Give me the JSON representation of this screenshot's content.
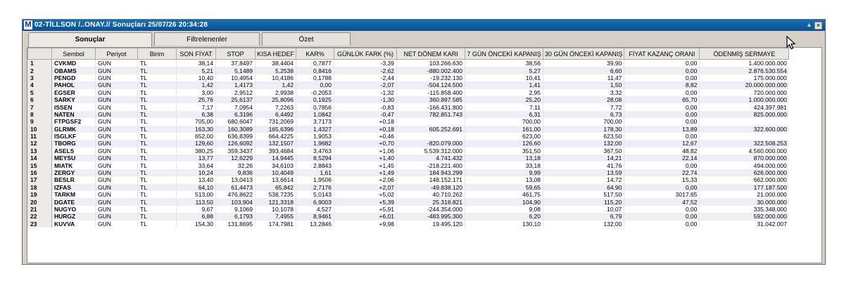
{
  "window": {
    "logo": "M",
    "title": "02-TİLLSON /..ONAY.// Sonuçları  25/07/26 20:34:28"
  },
  "tabs": [
    {
      "label": "Sonuçlar",
      "active": true
    },
    {
      "label": "Filtrelenenler",
      "active": false
    },
    {
      "label": "Özet",
      "active": false
    }
  ],
  "table": {
    "headers": [
      "",
      "Sembol",
      "Periyot",
      "Birim",
      "SON FİYAT",
      "STOP",
      "KISA HEDEF",
      "KAR%",
      "GÜNLÜK FARK (%)",
      "NET DÖNEM KARI",
      "7 GÜN ÖNCEKİ KAPANIŞ",
      "30 GÜN ÖNCEKİ KAPANIŞ",
      "FİYAT KAZANÇ ORANI",
      "ÖDENMİŞ SERMAYE"
    ],
    "rows": [
      [
        "1",
        "CVKMD",
        "GUN",
        "TL",
        "38,14",
        "37,8497",
        "38,4404",
        "0,7877",
        "-3,39",
        "103.266.630",
        "38,56",
        "39,90",
        "0,00",
        "1.400.000.000"
      ],
      [
        "2",
        "OBAMS",
        "GUN",
        "TL",
        "5,21",
        "5,1489",
        "5,2538",
        "0,8416",
        "-2,62",
        "-880.002.400",
        "5,27",
        "6,60",
        "0,00",
        "2.876.530.554"
      ],
      [
        "3",
        "PENGD",
        "GUN",
        "TL",
        "10,40",
        "10,4954",
        "10,4186",
        "0,1788",
        "-2,44",
        "-19.232.130",
        "10,41",
        "11,47",
        "0,00",
        "175.000.000"
      ],
      [
        "4",
        "PAHOL",
        "GUN",
        "TL",
        "1,42",
        "1,4173",
        "1,42",
        "0,00",
        "-2,07",
        "-504.124.500",
        "1,41",
        "1,50",
        "8,82",
        "20.000.000.000"
      ],
      [
        "5",
        "EGSER",
        "GUN",
        "TL",
        "3,00",
        "2,9512",
        "2,9938",
        "-0,2053",
        "-1,32",
        "-115.858.400",
        "2,95",
        "3,32",
        "0,00",
        "720.000.000"
      ],
      [
        "6",
        "SARKY",
        "GUN",
        "TL",
        "25,76",
        "25,6137",
        "25,8096",
        "0,1925",
        "-1,30",
        "360.897.585",
        "25,20",
        "28,08",
        "65,70",
        "1.000.000.000"
      ],
      [
        "7",
        "ISSEN",
        "GUN",
        "TL",
        "7,17",
        "7,0954",
        "7,2263",
        "0,7856",
        "-0,83",
        "-166.431.800",
        "7,11",
        "7,72",
        "0,00",
        "424.397.981"
      ],
      [
        "8",
        "NATEN",
        "GUN",
        "TL",
        "6,38",
        "6,3196",
        "6,4492",
        "1,0842",
        "-0,47",
        "782.851.743",
        "6,31",
        "6,73",
        "0,00",
        "825.000.000"
      ],
      [
        "9",
        "FTPGSF2",
        "GUN",
        "TL",
        "705,00",
        "680,6047",
        "731,2069",
        "3,7173",
        "+0,18",
        "",
        "700,00",
        "700,00",
        "0,00",
        ""
      ],
      [
        "10",
        "GLRMK",
        "GUN",
        "TL",
        "163,30",
        "160,3089",
        "165,6396",
        "1,4327",
        "+0,18",
        "605.252.691",
        "161,00",
        "178,30",
        "13,89",
        "322.600.000"
      ],
      [
        "11",
        "ISGLKF",
        "GUN",
        "TL",
        "652,00",
        "636,8399",
        "664,4225",
        "1,9053",
        "+0,46",
        "",
        "623,00",
        "623,50",
        "0,00",
        ""
      ],
      [
        "12",
        "TBORG",
        "GUN",
        "TL",
        "129,60",
        "126,6092",
        "132,1507",
        "1,9682",
        "+0,70",
        "-820.079.000",
        "126,60",
        "132,00",
        "12,67",
        "322.508.253"
      ],
      [
        "13",
        "ASELS",
        "GUN",
        "TL",
        "380,25",
        "359,3437",
        "393,4684",
        "3,4763",
        "+1,06",
        "5.539.312.000",
        "351,50",
        "367,50",
        "48,82",
        "4.560.000.000"
      ],
      [
        "14",
        "MEYSU",
        "GUN",
        "TL",
        "13,77",
        "12,6229",
        "14,9445",
        "8,5294",
        "+1,40",
        "4.741.432",
        "13,18",
        "14,21",
        "22,14",
        "870.000.000"
      ],
      [
        "15",
        "MIATK",
        "GUN",
        "TL",
        "33,64",
        "32,26",
        "34,6103",
        "2,8843",
        "+1,45",
        "-218.221.400",
        "33,18",
        "41,76",
        "0,00",
        "494.000.000"
      ],
      [
        "16",
        "ZERGY",
        "GUN",
        "TL",
        "10,24",
        "9,836",
        "10,4049",
        "1,61",
        "+1,49",
        "184.943.299",
        "9,99",
        "13,59",
        "22,74",
        "626.000.000"
      ],
      [
        "17",
        "BESLR",
        "GUN",
        "TL",
        "13,40",
        "13,0413",
        "13,6614",
        "1,9506",
        "+2,06",
        "148.152.171",
        "13,08",
        "14,72",
        "15,33",
        "662.000.000"
      ],
      [
        "18",
        "IZFAS",
        "GUN",
        "TL",
        "64,10",
        "61,4473",
        "65,842",
        "2,7176",
        "+2,07",
        "-49.838.120",
        "59,65",
        "64,90",
        "0,00",
        "177.187.500"
      ],
      [
        "19",
        "TARKM",
        "GUN",
        "TL",
        "513,00",
        "476,8622",
        "538,7235",
        "5,0143",
        "+5,02",
        "40.710.262",
        "461,75",
        "517,50",
        "3017,65",
        "21.000.000"
      ],
      [
        "20",
        "DGATE",
        "GUN",
        "TL",
        "113,50",
        "103,904",
        "121,3318",
        "6,9003",
        "+5,39",
        "25.318.821",
        "104,90",
        "115,20",
        "47,52",
        "30.000.000"
      ],
      [
        "21",
        "NUGYO",
        "GUN",
        "TL",
        "9,67",
        "9,1069",
        "10,1078",
        "4,527",
        "+5,91",
        "-244.354.000",
        "9,08",
        "10,07",
        "0,00",
        "335.348.000"
      ],
      [
        "22",
        "HURGZ",
        "GUN",
        "TL",
        "6,88",
        "6,1793",
        "7,4955",
        "8,9461",
        "+6,01",
        "-483.995.300",
        "6,20",
        "6,79",
        "0,00",
        "592.000.000"
      ],
      [
        "23",
        "KUVVA",
        "GUN",
        "TL",
        "154,30",
        "131,8695",
        "174,7981",
        "13,2846",
        "+9,98",
        "19.495.120",
        "130,10",
        "132,00",
        "0,00",
        "31.042.007"
      ]
    ]
  }
}
